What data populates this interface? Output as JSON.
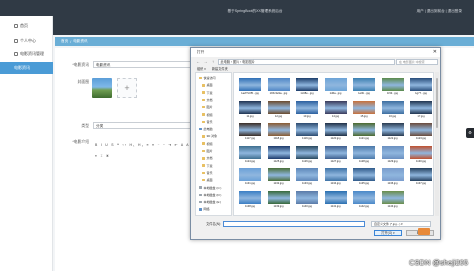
{
  "topbar": {
    "title": "基于SpringBoot的XX管理系统后台",
    "links": "用户  |  退出到前台  |  退出登录"
  },
  "sidebar": {
    "items": [
      {
        "label": "首页",
        "active": false
      },
      {
        "label": "个人中心",
        "active": false
      },
      {
        "label": "电影资讯管理",
        "active": false
      },
      {
        "label": "电影资讯",
        "active": true
      }
    ]
  },
  "breadcrumb": {
    "home": "首页",
    "sep": "/",
    "current": "电影资讯"
  },
  "form": {
    "title_label": "*电影资讯",
    "title_value": "电影资讯",
    "cover_label": "封面图",
    "add_symbol": "+",
    "category_label": "类型",
    "category_value": "分类",
    "content_label": "*电影介绍",
    "toolbar": "B I U S ❝ ‹› H₁ H₂ ≡ ≡ ⁻ ⁼ ⇥ ⇤ A A",
    "toolbar2": "≡ ⌶ ▣"
  },
  "dialog": {
    "title": "打开",
    "close": "✕",
    "path": "此电脑 › 图片 › 电影图片",
    "search_placeholder": "在 电影图片 中搜索",
    "commands": [
      "组织 ▾",
      "新建文件夹"
    ],
    "nav": [
      {
        "label": "快速访问",
        "kind": "folder"
      },
      {
        "label": "桌面",
        "kind": "folder"
      },
      {
        "label": "下载",
        "kind": "folder"
      },
      {
        "label": "文档",
        "kind": "folder"
      },
      {
        "label": "图片",
        "kind": "folder"
      },
      {
        "label": "视频",
        "kind": "folder"
      },
      {
        "label": "音乐",
        "kind": "folder"
      },
      {
        "label": "此电脑",
        "kind": "pc"
      },
      {
        "label": "3D 对象",
        "kind": "folder"
      },
      {
        "label": "视频",
        "kind": "folder"
      },
      {
        "label": "图片",
        "kind": "folder"
      },
      {
        "label": "文档",
        "kind": "folder"
      },
      {
        "label": "下载",
        "kind": "folder"
      },
      {
        "label": "音乐",
        "kind": "folder"
      },
      {
        "label": "桌面",
        "kind": "folder"
      },
      {
        "label": "本地磁盘 (C:)",
        "kind": "drive"
      },
      {
        "label": "本地磁盘 (D:)",
        "kind": "drive"
      },
      {
        "label": "本地磁盘 (E:)",
        "kind": "drive"
      },
      {
        "label": "网络",
        "kind": "pc"
      }
    ],
    "files": [
      {
        "name": "1a2f7c0f5...jpg",
        "color": "#2f6fb5"
      },
      {
        "name": "1b5c3e9a...jpg",
        "color": "#4f86c6"
      },
      {
        "name": "1c08e...jpg",
        "color": "#1c3d6b"
      },
      {
        "name": "1d6a...jpg",
        "color": "#6ba3d6"
      },
      {
        "name": "1e0b...jpg",
        "color": "#3a7fb0"
      },
      {
        "name": "1f33...jpg",
        "color": "#5b8a4c"
      },
      {
        "name": "1g77...jpg",
        "color": "#294d7a"
      },
      {
        "name": "11.jpg",
        "color": "#1e3250"
      },
      {
        "name": "12.jpg",
        "color": "#6b4a2c"
      },
      {
        "name": "13.jpg",
        "color": "#2b5f9e"
      },
      {
        "name": "14.jpg",
        "color": "#3a3a5a"
      },
      {
        "name": "15.jpg",
        "color": "#c8703a"
      },
      {
        "name": "16.jpg",
        "color": "#3d6e9f"
      },
      {
        "name": "17.jpg",
        "color": "#20344f"
      },
      {
        "name": "1117.jpg",
        "color": "#3a2c24"
      },
      {
        "name": "1118.jpg",
        "color": "#8a5a30"
      },
      {
        "name": "1119.jpg",
        "color": "#2c4a6e"
      },
      {
        "name": "1120.jpg",
        "color": "#1f2f45"
      },
      {
        "name": "1121.jpg",
        "color": "#4c6a2e"
      },
      {
        "name": "1122.jpg",
        "color": "#2a3a4f"
      },
      {
        "name": "1123.jpg",
        "color": "#6a4a3a"
      },
      {
        "name": "1124.jpg",
        "color": "#3f6f8f"
      },
      {
        "name": "1125.jpg",
        "color": "#1d3a6b"
      },
      {
        "name": "1126.jpg",
        "color": "#28485e"
      },
      {
        "name": "1127.jpg",
        "color": "#3e5e8e"
      },
      {
        "name": "1128.jpg",
        "color": "#4a78a8"
      },
      {
        "name": "1129.jpg",
        "color": "#6a8fc0"
      },
      {
        "name": "1130.jpg",
        "color": "#c0502e"
      },
      {
        "name": "1131.jpg",
        "color": "#6aa0d8"
      },
      {
        "name": "1132.jpg",
        "color": "#4a6f3a"
      },
      {
        "name": "1133.jpg",
        "color": "#5d86b8"
      },
      {
        "name": "1134.jpg",
        "color": "#3e72a6"
      },
      {
        "name": "1135.jpg",
        "color": "#2f5a8a"
      },
      {
        "name": "1136.jpg",
        "color": "#7a9ccc"
      },
      {
        "name": "1137.jpg",
        "color": "#24405e"
      },
      {
        "name": "1138.jpg",
        "color": "#3b7ec4"
      },
      {
        "name": "1139.jpg",
        "color": "#386a3a"
      },
      {
        "name": "1140.jpg",
        "color": "#5a7aa8"
      },
      {
        "name": "1141.jpg",
        "color": "#2a6fb0"
      },
      {
        "name": "1142.jpg",
        "color": "#4a88c8"
      },
      {
        "name": "1143.jpg",
        "color": "#6a8e4a"
      }
    ],
    "filename_label": "文件名(N):",
    "filter_value": "自定义文件 (*.jpg...) ▾",
    "open_button": "打开(O) ▾",
    "cancel_button": "取消"
  },
  "float_button": "⚙",
  "watermark": "CSDN @sheji205"
}
